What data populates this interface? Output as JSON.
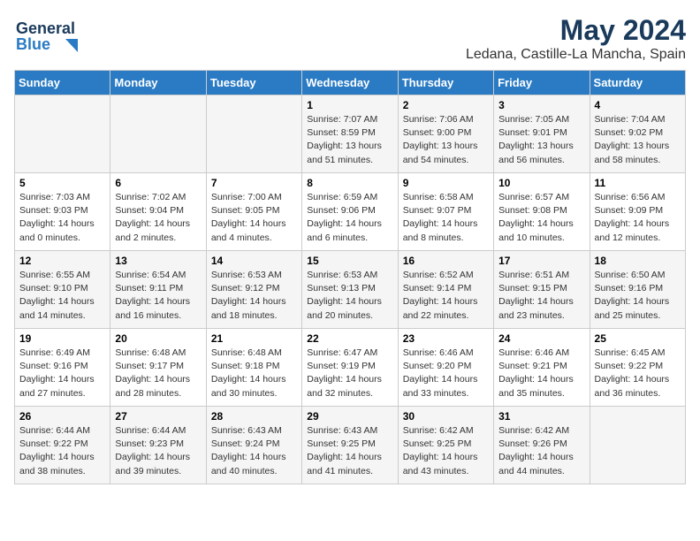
{
  "header": {
    "logo_line1": "General",
    "logo_line2": "Blue",
    "title": "May 2024",
    "subtitle": "Ledana, Castille-La Mancha, Spain"
  },
  "weekdays": [
    "Sunday",
    "Monday",
    "Tuesday",
    "Wednesday",
    "Thursday",
    "Friday",
    "Saturday"
  ],
  "weeks": [
    [
      {
        "day": "",
        "info": ""
      },
      {
        "day": "",
        "info": ""
      },
      {
        "day": "",
        "info": ""
      },
      {
        "day": "1",
        "info": "Sunrise: 7:07 AM\nSunset: 8:59 PM\nDaylight: 13 hours\nand 51 minutes."
      },
      {
        "day": "2",
        "info": "Sunrise: 7:06 AM\nSunset: 9:00 PM\nDaylight: 13 hours\nand 54 minutes."
      },
      {
        "day": "3",
        "info": "Sunrise: 7:05 AM\nSunset: 9:01 PM\nDaylight: 13 hours\nand 56 minutes."
      },
      {
        "day": "4",
        "info": "Sunrise: 7:04 AM\nSunset: 9:02 PM\nDaylight: 13 hours\nand 58 minutes."
      }
    ],
    [
      {
        "day": "5",
        "info": "Sunrise: 7:03 AM\nSunset: 9:03 PM\nDaylight: 14 hours\nand 0 minutes."
      },
      {
        "day": "6",
        "info": "Sunrise: 7:02 AM\nSunset: 9:04 PM\nDaylight: 14 hours\nand 2 minutes."
      },
      {
        "day": "7",
        "info": "Sunrise: 7:00 AM\nSunset: 9:05 PM\nDaylight: 14 hours\nand 4 minutes."
      },
      {
        "day": "8",
        "info": "Sunrise: 6:59 AM\nSunset: 9:06 PM\nDaylight: 14 hours\nand 6 minutes."
      },
      {
        "day": "9",
        "info": "Sunrise: 6:58 AM\nSunset: 9:07 PM\nDaylight: 14 hours\nand 8 minutes."
      },
      {
        "day": "10",
        "info": "Sunrise: 6:57 AM\nSunset: 9:08 PM\nDaylight: 14 hours\nand 10 minutes."
      },
      {
        "day": "11",
        "info": "Sunrise: 6:56 AM\nSunset: 9:09 PM\nDaylight: 14 hours\nand 12 minutes."
      }
    ],
    [
      {
        "day": "12",
        "info": "Sunrise: 6:55 AM\nSunset: 9:10 PM\nDaylight: 14 hours\nand 14 minutes."
      },
      {
        "day": "13",
        "info": "Sunrise: 6:54 AM\nSunset: 9:11 PM\nDaylight: 14 hours\nand 16 minutes."
      },
      {
        "day": "14",
        "info": "Sunrise: 6:53 AM\nSunset: 9:12 PM\nDaylight: 14 hours\nand 18 minutes."
      },
      {
        "day": "15",
        "info": "Sunrise: 6:53 AM\nSunset: 9:13 PM\nDaylight: 14 hours\nand 20 minutes."
      },
      {
        "day": "16",
        "info": "Sunrise: 6:52 AM\nSunset: 9:14 PM\nDaylight: 14 hours\nand 22 minutes."
      },
      {
        "day": "17",
        "info": "Sunrise: 6:51 AM\nSunset: 9:15 PM\nDaylight: 14 hours\nand 23 minutes."
      },
      {
        "day": "18",
        "info": "Sunrise: 6:50 AM\nSunset: 9:16 PM\nDaylight: 14 hours\nand 25 minutes."
      }
    ],
    [
      {
        "day": "19",
        "info": "Sunrise: 6:49 AM\nSunset: 9:16 PM\nDaylight: 14 hours\nand 27 minutes."
      },
      {
        "day": "20",
        "info": "Sunrise: 6:48 AM\nSunset: 9:17 PM\nDaylight: 14 hours\nand 28 minutes."
      },
      {
        "day": "21",
        "info": "Sunrise: 6:48 AM\nSunset: 9:18 PM\nDaylight: 14 hours\nand 30 minutes."
      },
      {
        "day": "22",
        "info": "Sunrise: 6:47 AM\nSunset: 9:19 PM\nDaylight: 14 hours\nand 32 minutes."
      },
      {
        "day": "23",
        "info": "Sunrise: 6:46 AM\nSunset: 9:20 PM\nDaylight: 14 hours\nand 33 minutes."
      },
      {
        "day": "24",
        "info": "Sunrise: 6:46 AM\nSunset: 9:21 PM\nDaylight: 14 hours\nand 35 minutes."
      },
      {
        "day": "25",
        "info": "Sunrise: 6:45 AM\nSunset: 9:22 PM\nDaylight: 14 hours\nand 36 minutes."
      }
    ],
    [
      {
        "day": "26",
        "info": "Sunrise: 6:44 AM\nSunset: 9:22 PM\nDaylight: 14 hours\nand 38 minutes."
      },
      {
        "day": "27",
        "info": "Sunrise: 6:44 AM\nSunset: 9:23 PM\nDaylight: 14 hours\nand 39 minutes."
      },
      {
        "day": "28",
        "info": "Sunrise: 6:43 AM\nSunset: 9:24 PM\nDaylight: 14 hours\nand 40 minutes."
      },
      {
        "day": "29",
        "info": "Sunrise: 6:43 AM\nSunset: 9:25 PM\nDaylight: 14 hours\nand 41 minutes."
      },
      {
        "day": "30",
        "info": "Sunrise: 6:42 AM\nSunset: 9:25 PM\nDaylight: 14 hours\nand 43 minutes."
      },
      {
        "day": "31",
        "info": "Sunrise: 6:42 AM\nSunset: 9:26 PM\nDaylight: 14 hours\nand 44 minutes."
      },
      {
        "day": "",
        "info": ""
      }
    ]
  ]
}
